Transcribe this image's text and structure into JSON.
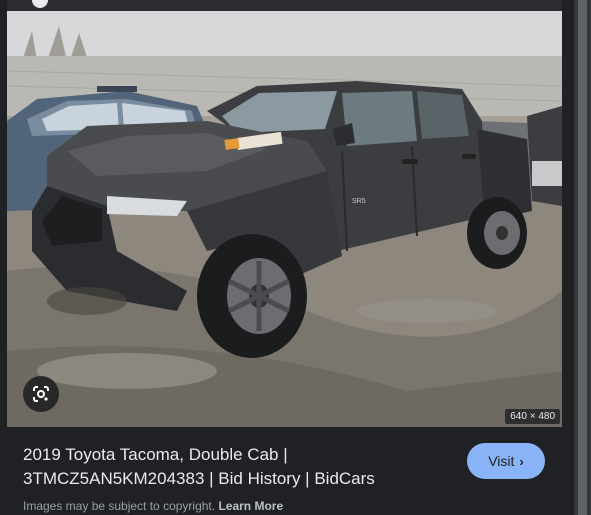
{
  "image": {
    "alt": "Damaged dark gray 2019 Toyota Tacoma double cab pickup truck parked in a muddy salvage lot",
    "dimensions": "640 × 480",
    "badge_text": "SR5"
  },
  "result": {
    "title": "2019 Toyota Tacoma, Double Cab | 3TMCZ5AN5KM204383 | Bid History | BidCars",
    "visit_label": "Visit",
    "visit_chevron": "›"
  },
  "footer": {
    "copyright_text": "Images may be subject to copyright.",
    "learn_more": "Learn More"
  },
  "icons": {
    "lens": "google-lens-icon",
    "chevron": "chevron-right-icon"
  },
  "colors": {
    "panel_bg": "#202124",
    "visit_bg": "#8ab4f8",
    "title_text": "#e8eaed",
    "muted_text": "#9aa0a6"
  }
}
